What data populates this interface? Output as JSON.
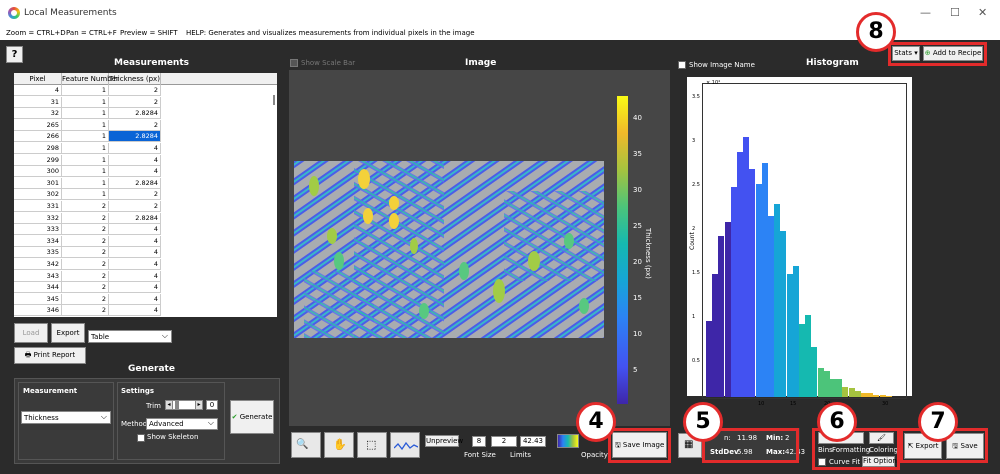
{
  "window": {
    "title": "Local Measurements",
    "controls": {
      "minimize": "—",
      "maximize": "☐",
      "close": "✕"
    }
  },
  "help": {
    "zoom": "Zoom = CTRL+D",
    "pan": "Pan = CTRL+F",
    "preview": "Preview = SHIFT",
    "help": "HELP:  Generates and visualizes measurements from individual pixels in the image"
  },
  "question_label": "?",
  "measurements": {
    "title": "Measurements",
    "columns": [
      "Pixel",
      "Feature Number",
      "Thickness (px)"
    ],
    "rows": [
      [
        "4",
        "1",
        "2"
      ],
      [
        "31",
        "1",
        "2"
      ],
      [
        "32",
        "1",
        "2.8284"
      ],
      [
        "265",
        "1",
        "2"
      ],
      [
        "266",
        "1",
        "2.8284"
      ],
      [
        "298",
        "1",
        "4"
      ],
      [
        "299",
        "1",
        "4"
      ],
      [
        "300",
        "1",
        "4"
      ],
      [
        "301",
        "1",
        "2.8284"
      ],
      [
        "302",
        "1",
        "2"
      ],
      [
        "331",
        "2",
        "2"
      ],
      [
        "332",
        "2",
        "2.8284"
      ],
      [
        "333",
        "2",
        "4"
      ],
      [
        "334",
        "2",
        "4"
      ],
      [
        "335",
        "2",
        "4"
      ],
      [
        "342",
        "2",
        "4"
      ],
      [
        "343",
        "2",
        "4"
      ],
      [
        "344",
        "2",
        "4"
      ],
      [
        "345",
        "2",
        "4"
      ],
      [
        "346",
        "2",
        "4"
      ]
    ],
    "selected_row": 4,
    "load_label": "Load",
    "export_label": "Export",
    "table_select": "Table",
    "print_label": "Print Report"
  },
  "generate": {
    "title": "Generate",
    "measurement_heading": "Measurement",
    "measurement_value": "Thickness",
    "settings_heading": "Settings",
    "trim_label": "Trim",
    "trim_value": "0",
    "method_label": "Method",
    "method_value": "Advanced",
    "show_skeleton": "Show Skeleton",
    "generate_label": "Generate",
    "check_glyph": "✔"
  },
  "image": {
    "title": "Image",
    "show_scale_bar": "Show Scale Bar",
    "colorbar_label": "Thickness (px)",
    "colorbar_ticks": [
      "40",
      "35",
      "30",
      "25",
      "20",
      "15",
      "10",
      "5"
    ],
    "unpreview_label": "Unpreview",
    "font_size_value": "8",
    "font_size_label": "Font Size",
    "limit_min": "2",
    "limit_max": "42.43",
    "limits_label": "Limits",
    "opacity_label": "Opacity",
    "save_image_label": "Save Image"
  },
  "histogram": {
    "title": "Histogram",
    "show_image_name": "Show Image Name",
    "stats_label": "Stats",
    "add_recipe_label": "Add to Recipe",
    "ylabel": "Count",
    "exponent": "× 10⁴",
    "yticks": [
      "3.5",
      "3",
      "2.5",
      "2",
      "1.5",
      "1",
      "0.5"
    ],
    "xticks": [
      "10",
      "15",
      "20",
      "30"
    ],
    "bars": [
      0.26,
      0.42,
      0.55,
      0.6,
      0.72,
      0.84,
      0.89,
      0.78,
      0.73,
      0.8,
      0.62,
      0.66,
      0.57,
      0.42,
      0.45,
      0.25,
      0.28,
      0.17,
      0.1,
      0.09,
      0.06,
      0.06,
      0.035,
      0.03,
      0.02,
      0.015,
      0.012,
      0.008,
      0.006,
      0.004
    ],
    "stats": {
      "mean_label": "n:",
      "mean": "11.98",
      "min_label": "Min:",
      "min": "2",
      "std_label": "StdDev",
      "std": "5.98",
      "max_label": "Max:",
      "max": "42.43"
    },
    "bins_label": "Bins",
    "formatting_label": "Formatting",
    "coloring_label": "Coloring",
    "curve_fit_label": "Curve Fit",
    "fit_option_label": "Fit Option",
    "export_label": "Export",
    "save_label": "Save"
  },
  "callouts": [
    "4",
    "5",
    "6",
    "7",
    "8"
  ],
  "colors": {
    "accent_red": "#e32b2b",
    "selection": "#0a64d6",
    "dark_bg": "#2b2b2b"
  }
}
